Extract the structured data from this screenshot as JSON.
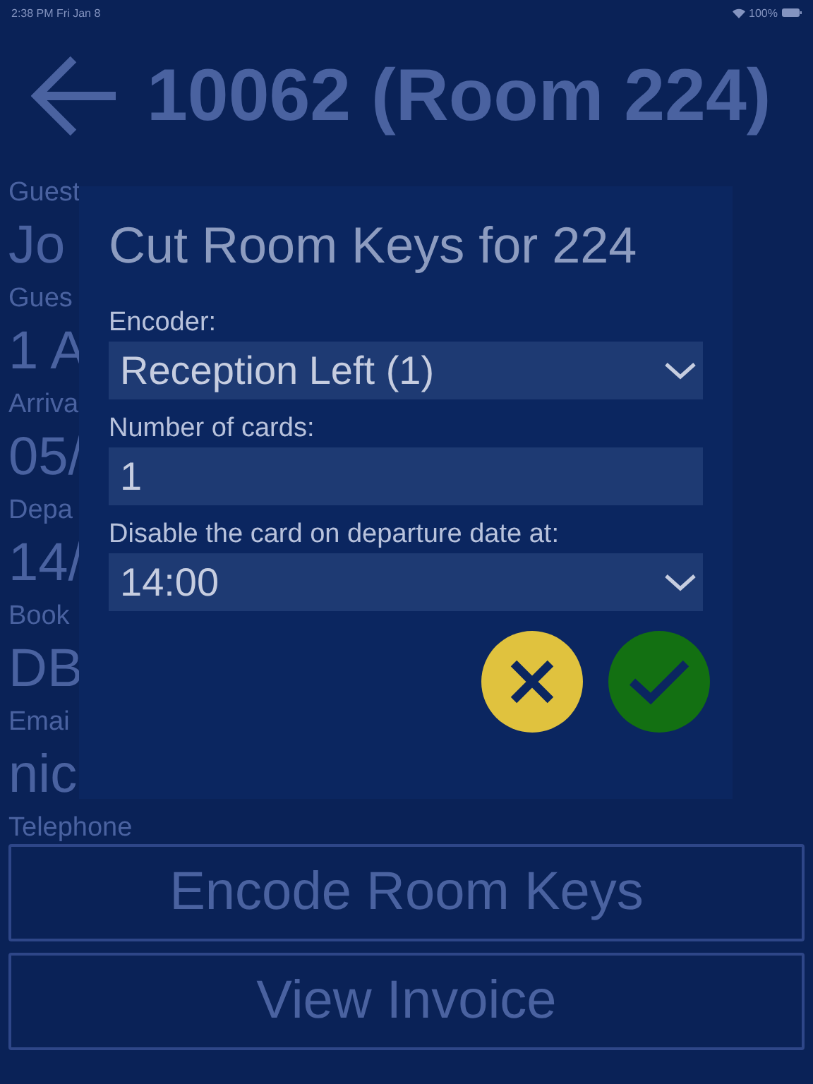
{
  "status_bar": {
    "time": "2:38 PM  Fri Jan 8",
    "battery": "100%"
  },
  "header": {
    "title": "10062 (Room 224)"
  },
  "fields": [
    {
      "label": "Guest",
      "value": "Jo"
    },
    {
      "label": "Gues",
      "value": "1 A"
    },
    {
      "label": "Arriva",
      "value": "05/"
    },
    {
      "label": "Depa",
      "value": "14/"
    },
    {
      "label": "Book",
      "value": "DB"
    },
    {
      "label": "Emai",
      "value": "nic"
    },
    {
      "label": "Telephone"
    }
  ],
  "actions": [
    "Encode Room Keys",
    "View Invoice"
  ],
  "dialog": {
    "title": "Cut Room Keys for 224",
    "controls": [
      {
        "kind": "select",
        "label": "Encoder:",
        "value": "Reception Left (1)"
      },
      {
        "kind": "input",
        "label": "Number of cards:",
        "value": "1"
      },
      {
        "kind": "select",
        "label": "Disable the card on departure date at:",
        "value": "14:00"
      }
    ]
  }
}
